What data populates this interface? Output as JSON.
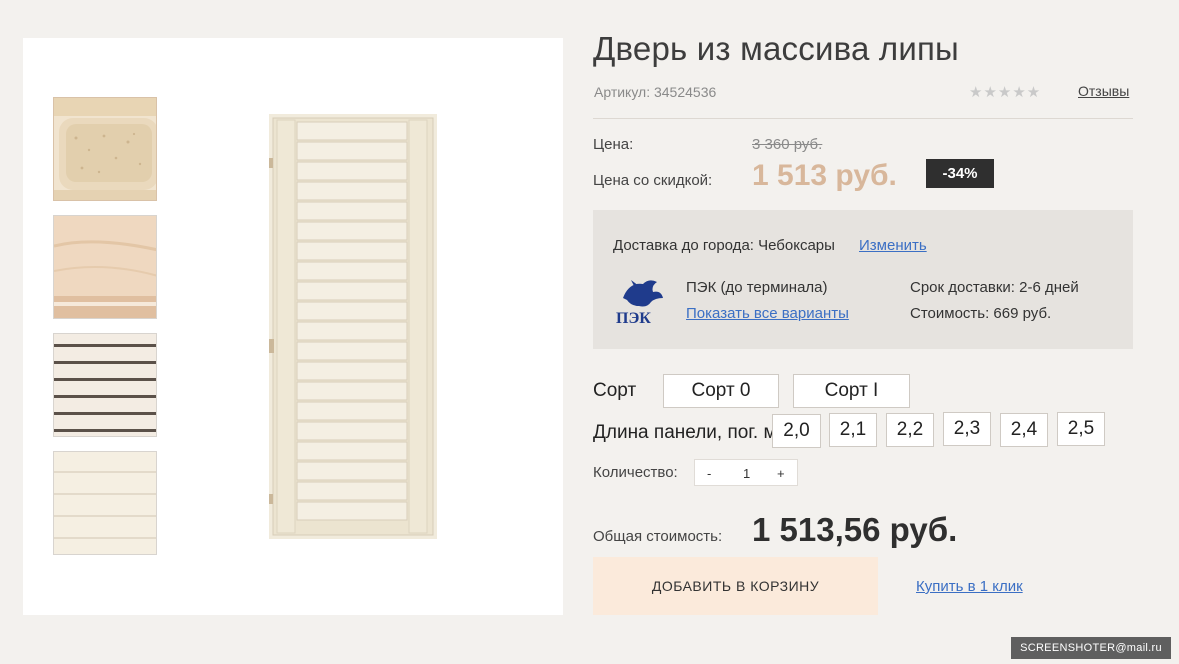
{
  "product": {
    "title": "Дверь из массива липы",
    "sku": "Артикул: 34524536",
    "stars": "★★★★★",
    "reviews_label": "Отзывы"
  },
  "pricing": {
    "price_label": "Цена:",
    "old_price": "3 360 руб.",
    "sale_label": "Цена со скидкой:",
    "sale_price": "1 513 руб.",
    "discount": "-34%"
  },
  "delivery": {
    "city_text": "Доставка до города: Чебоксары",
    "change_label": "Изменить",
    "carrier": "ПЭК (до терминала)",
    "carrier_logo_text": "ПЭК",
    "variants_link": "Показать все варианты",
    "term": "Срок доставки: 2-6 дней",
    "cost": "Стоимость: 669 руб."
  },
  "options": {
    "grade_label": "Сорт",
    "grade_options": [
      "Сорт 0",
      "Сорт I"
    ],
    "length_label": "Длина панели, пог. м",
    "length_options": [
      "2,0",
      "2,1",
      "2,2",
      "2,3",
      "2,4",
      "2,5"
    ]
  },
  "quantity": {
    "label": "Количество:",
    "minus": "-",
    "value": "1",
    "plus": "+"
  },
  "total": {
    "label": "Общая стоимость:",
    "value": "1 513,56 руб."
  },
  "actions": {
    "add_to_cart": "ДОБАВИТЬ В КОРЗИНУ",
    "buy_one_click": "Купить в 1 клик"
  },
  "watermark": "SCREENSHOTER@mail.ru",
  "colors": {
    "accent_price": "#d8b79b",
    "link": "#3b6fc4",
    "cart_button": "#fbeadb",
    "discount_badge": "#2f2f2f"
  }
}
